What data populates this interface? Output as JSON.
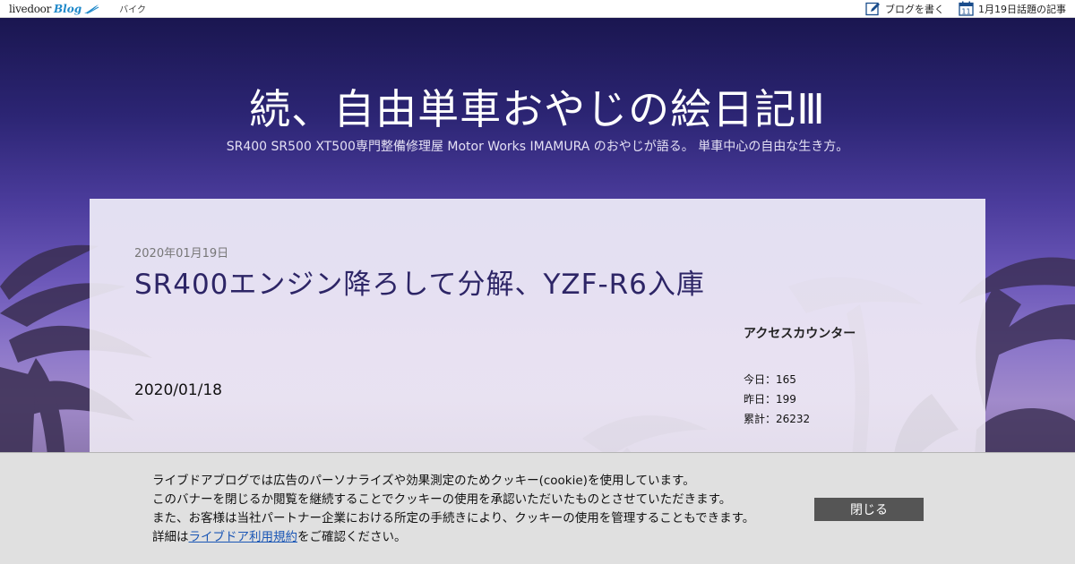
{
  "topbar": {
    "brand_livedoor": "livedoor",
    "brand_blog": "Blog",
    "category": "バイク",
    "write_blog": "ブログを書く",
    "calendar_day": "11",
    "trending": "1月19日話題の記事"
  },
  "blog": {
    "title": "続、自由単車おやじの絵日記Ⅲ",
    "description": "SR400 SR500 XT500専門整備修理屋 Motor Works IMAMURA のおやじが語る。 単車中心の自由な生き方。"
  },
  "post": {
    "date": "2020年01月19日",
    "title": "SR400エンジン降ろして分解、YZF-R6入庫",
    "body_date": "2020/01/18"
  },
  "sidebar": {
    "counter_title": "アクセスカウンター",
    "today": "今日：165",
    "yesterday": "昨日：199",
    "total": "累計：26232"
  },
  "cookie": {
    "line1": "ライブドアブログでは広告のパーソナライズや効果測定のためクッキー(cookie)を使用しています。",
    "line2": "このバナーを閉じるか閲覧を継続することでクッキーの使用を承認いただいたものとさせていただきます。",
    "line3": "また、お客様は当社パートナー企業における所定の手続きにより、クッキーの使用を管理することもできます。",
    "line4_prefix": "詳細は",
    "line4_link": "ライブドア利用規約",
    "line4_suffix": "をご確認ください。",
    "close_label": "閉じる"
  },
  "colors": {
    "title_text": "#2d2566",
    "link": "#1a56b5",
    "close_button": "#555555"
  }
}
